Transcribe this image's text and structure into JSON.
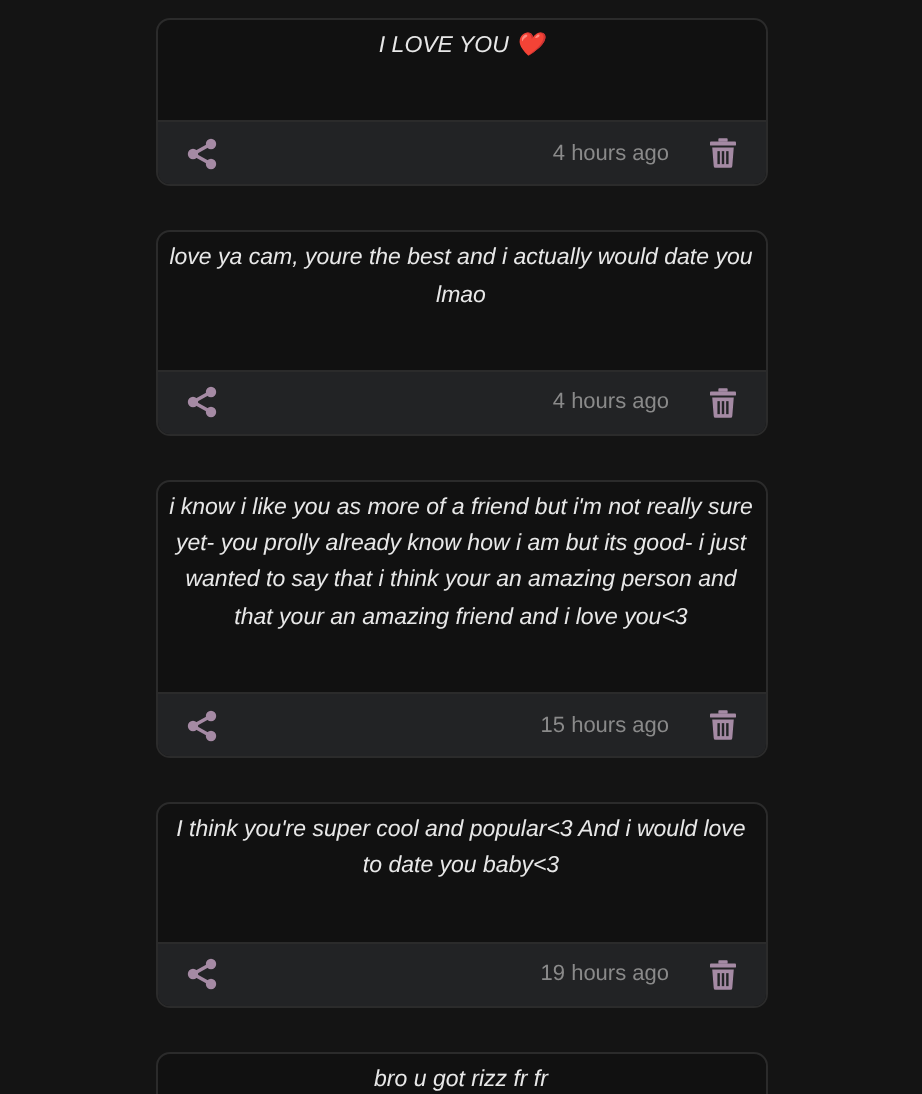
{
  "messages": [
    {
      "text": "I LOVE YOU ❤️",
      "time": "4 hours ago"
    },
    {
      "text": "love ya cam, youre the best and i actually would date you lmao",
      "time": "4 hours ago"
    },
    {
      "text": "i know i like you as more of a friend but i'm not really sure yet- you prolly already know how i am but its good- i just wanted to say that i think your an amazing person and that your an amazing friend and i love you<3",
      "time": "15 hours ago"
    },
    {
      "text": "I think you're super cool and popular<3 And i would love to date you baby<3",
      "time": "19 hours ago"
    },
    {
      "text": "bro u got rizz fr fr"
    }
  ]
}
